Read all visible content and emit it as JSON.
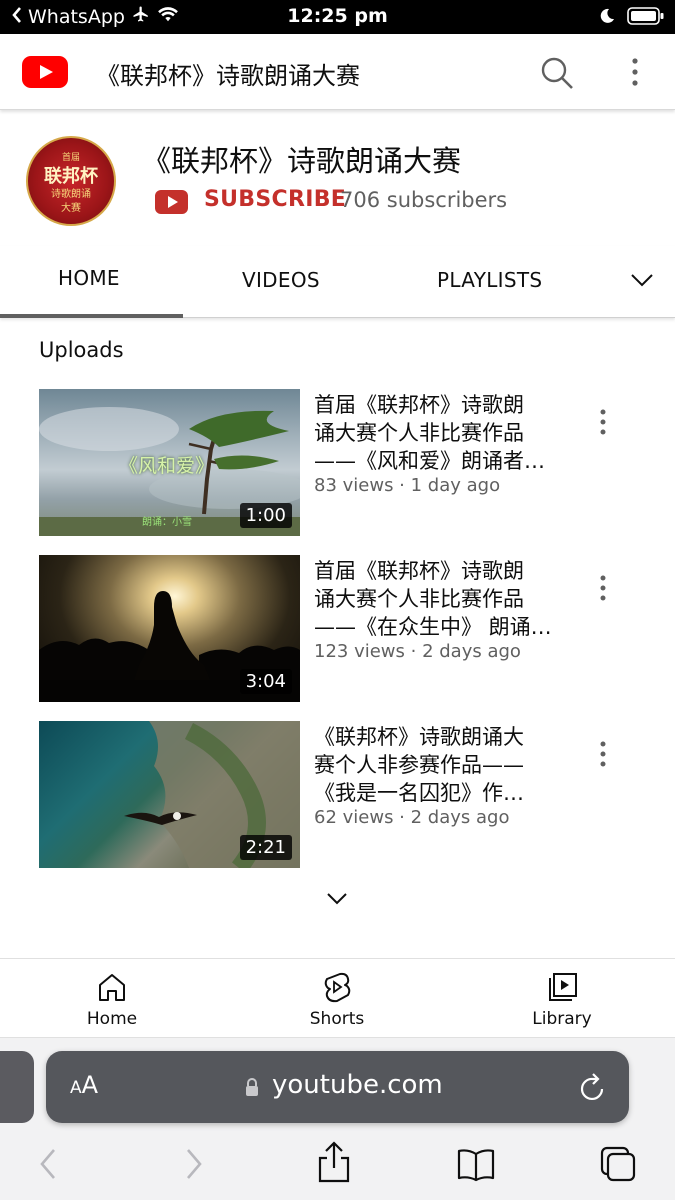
{
  "status_bar": {
    "back_app": "WhatsApp",
    "time": "12:25 pm"
  },
  "header": {
    "title": "《联邦杯》诗歌朗诵大赛",
    "icons": [
      "youtube-logo-icon",
      "search-icon",
      "more-vertical-icon"
    ]
  },
  "channel": {
    "name": "《联邦杯》诗歌朗诵大赛",
    "avatar_text": {
      "line1": "首届",
      "line2": "联邦杯",
      "line3": "诗歌朗诵",
      "line4": "大赛"
    },
    "subscribe_label": "SUBSCRIBE",
    "subscribers": "706 subscribers"
  },
  "tabs": [
    {
      "label": "HOME",
      "active": true
    },
    {
      "label": "VIDEOS",
      "active": false
    },
    {
      "label": "PLAYLISTS",
      "active": false
    }
  ],
  "uploads": {
    "title": "Uploads",
    "videos": [
      {
        "title_lines": [
          "首届《联邦杯》诗歌朗",
          "诵大赛个人非比赛作品",
          "——《风和爱》朗诵者…"
        ],
        "meta": "83 views · 1 day ago",
        "duration": "1:00",
        "overlay_text": "《风和爱》",
        "overlay_caption": "朗诵：小雪"
      },
      {
        "title_lines": [
          "首届《联邦杯》诗歌朗",
          "诵大赛个人非比赛作品",
          "——《在众生中》 朗诵…"
        ],
        "meta": "123 views · 2 days ago",
        "duration": "3:04"
      },
      {
        "title_lines": [
          "《联邦杯》诗歌朗诵大",
          "赛个人非参赛作品——",
          "《我是一名囚犯》作…"
        ],
        "meta": "62 views · 2 days ago",
        "duration": "2:21"
      }
    ]
  },
  "bottom_nav": [
    {
      "label": "Home",
      "icon": "home-icon"
    },
    {
      "label": "Shorts",
      "icon": "shorts-icon"
    },
    {
      "label": "Library",
      "icon": "library-icon"
    }
  ],
  "safari": {
    "aa_big": "A",
    "aa_small": "A",
    "url": "youtube.com",
    "colors": {
      "url_bar": "#55575c",
      "toolbar": "#f2f2f3"
    }
  },
  "colors": {
    "youtube_red": "#ff0000",
    "subscribe_red": "#c4302b",
    "secondary_text": "#606060"
  }
}
